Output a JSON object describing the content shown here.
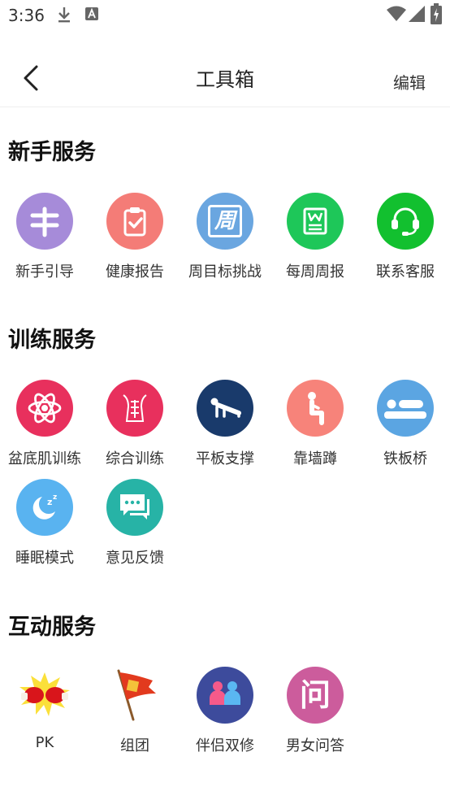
{
  "status": {
    "time": "3:36"
  },
  "nav": {
    "title": "工具箱",
    "edit": "编辑"
  },
  "sections": [
    {
      "title": "新手服务",
      "items": [
        "新手引导",
        "健康报告",
        "周目标挑战",
        "每周周报",
        "联系客服"
      ]
    },
    {
      "title": "训练服务",
      "items": [
        "盆底肌训练",
        "综合训练",
        "平板支撑",
        "靠墙蹲",
        "铁板桥",
        "睡眠模式",
        "意见反馈"
      ]
    },
    {
      "title": "互动服务",
      "items": [
        "PK",
        "组团",
        "伴侣双修",
        "男女问答"
      ]
    }
  ],
  "icon_glyphs": {
    "weekly_challenge": "周",
    "qa": "问"
  },
  "colors": {
    "purple": "#a68bd9",
    "coral": "#f47c77",
    "blue": "#6aa6e0",
    "green": "#1ec759",
    "green2": "#12c02f",
    "crimson": "#e8305d",
    "navy": "#193a6b",
    "salmon": "#f7837a",
    "skyblue": "#5ba5e2",
    "lightblue": "#59b3f0",
    "teal": "#27b3a6",
    "indigo": "#3d4b9c",
    "pink": "#cc5c9c"
  }
}
